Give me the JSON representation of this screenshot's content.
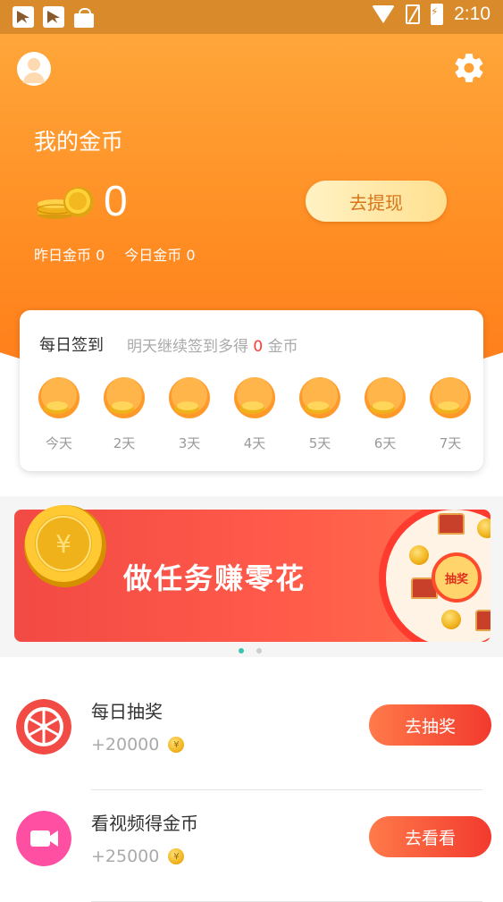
{
  "status_bar": {
    "time": "2:10"
  },
  "header": {
    "title": "我的金币",
    "coin_count": "0",
    "withdraw_label": "去提现",
    "yesterday": "昨日金币 0",
    "today": "今日金币 0",
    "colors": {
      "top": "#ffa63a",
      "bottom": "#ff7c1a"
    }
  },
  "signin": {
    "title": "每日签到",
    "hint_prefix": "明天继续签到多得",
    "hint_value": "0",
    "hint_suffix": "金币",
    "days": [
      "今天",
      "2天",
      "3天",
      "4天",
      "5天",
      "6天",
      "7天"
    ]
  },
  "banner": {
    "text": "做任务赚零花",
    "wheel_label": "抽奖",
    "pages": 2,
    "active_page": 1
  },
  "tasks": [
    {
      "title": "每日抽奖",
      "reward": "+20000",
      "button": "去抽奖",
      "icon": "prize-wheel-icon",
      "icon_color": "#f24a44"
    },
    {
      "title": "看视频得金币",
      "reward": "+25000",
      "button": "去看看",
      "icon": "video-camera-icon",
      "icon_color": "#ff4fa3"
    }
  ]
}
